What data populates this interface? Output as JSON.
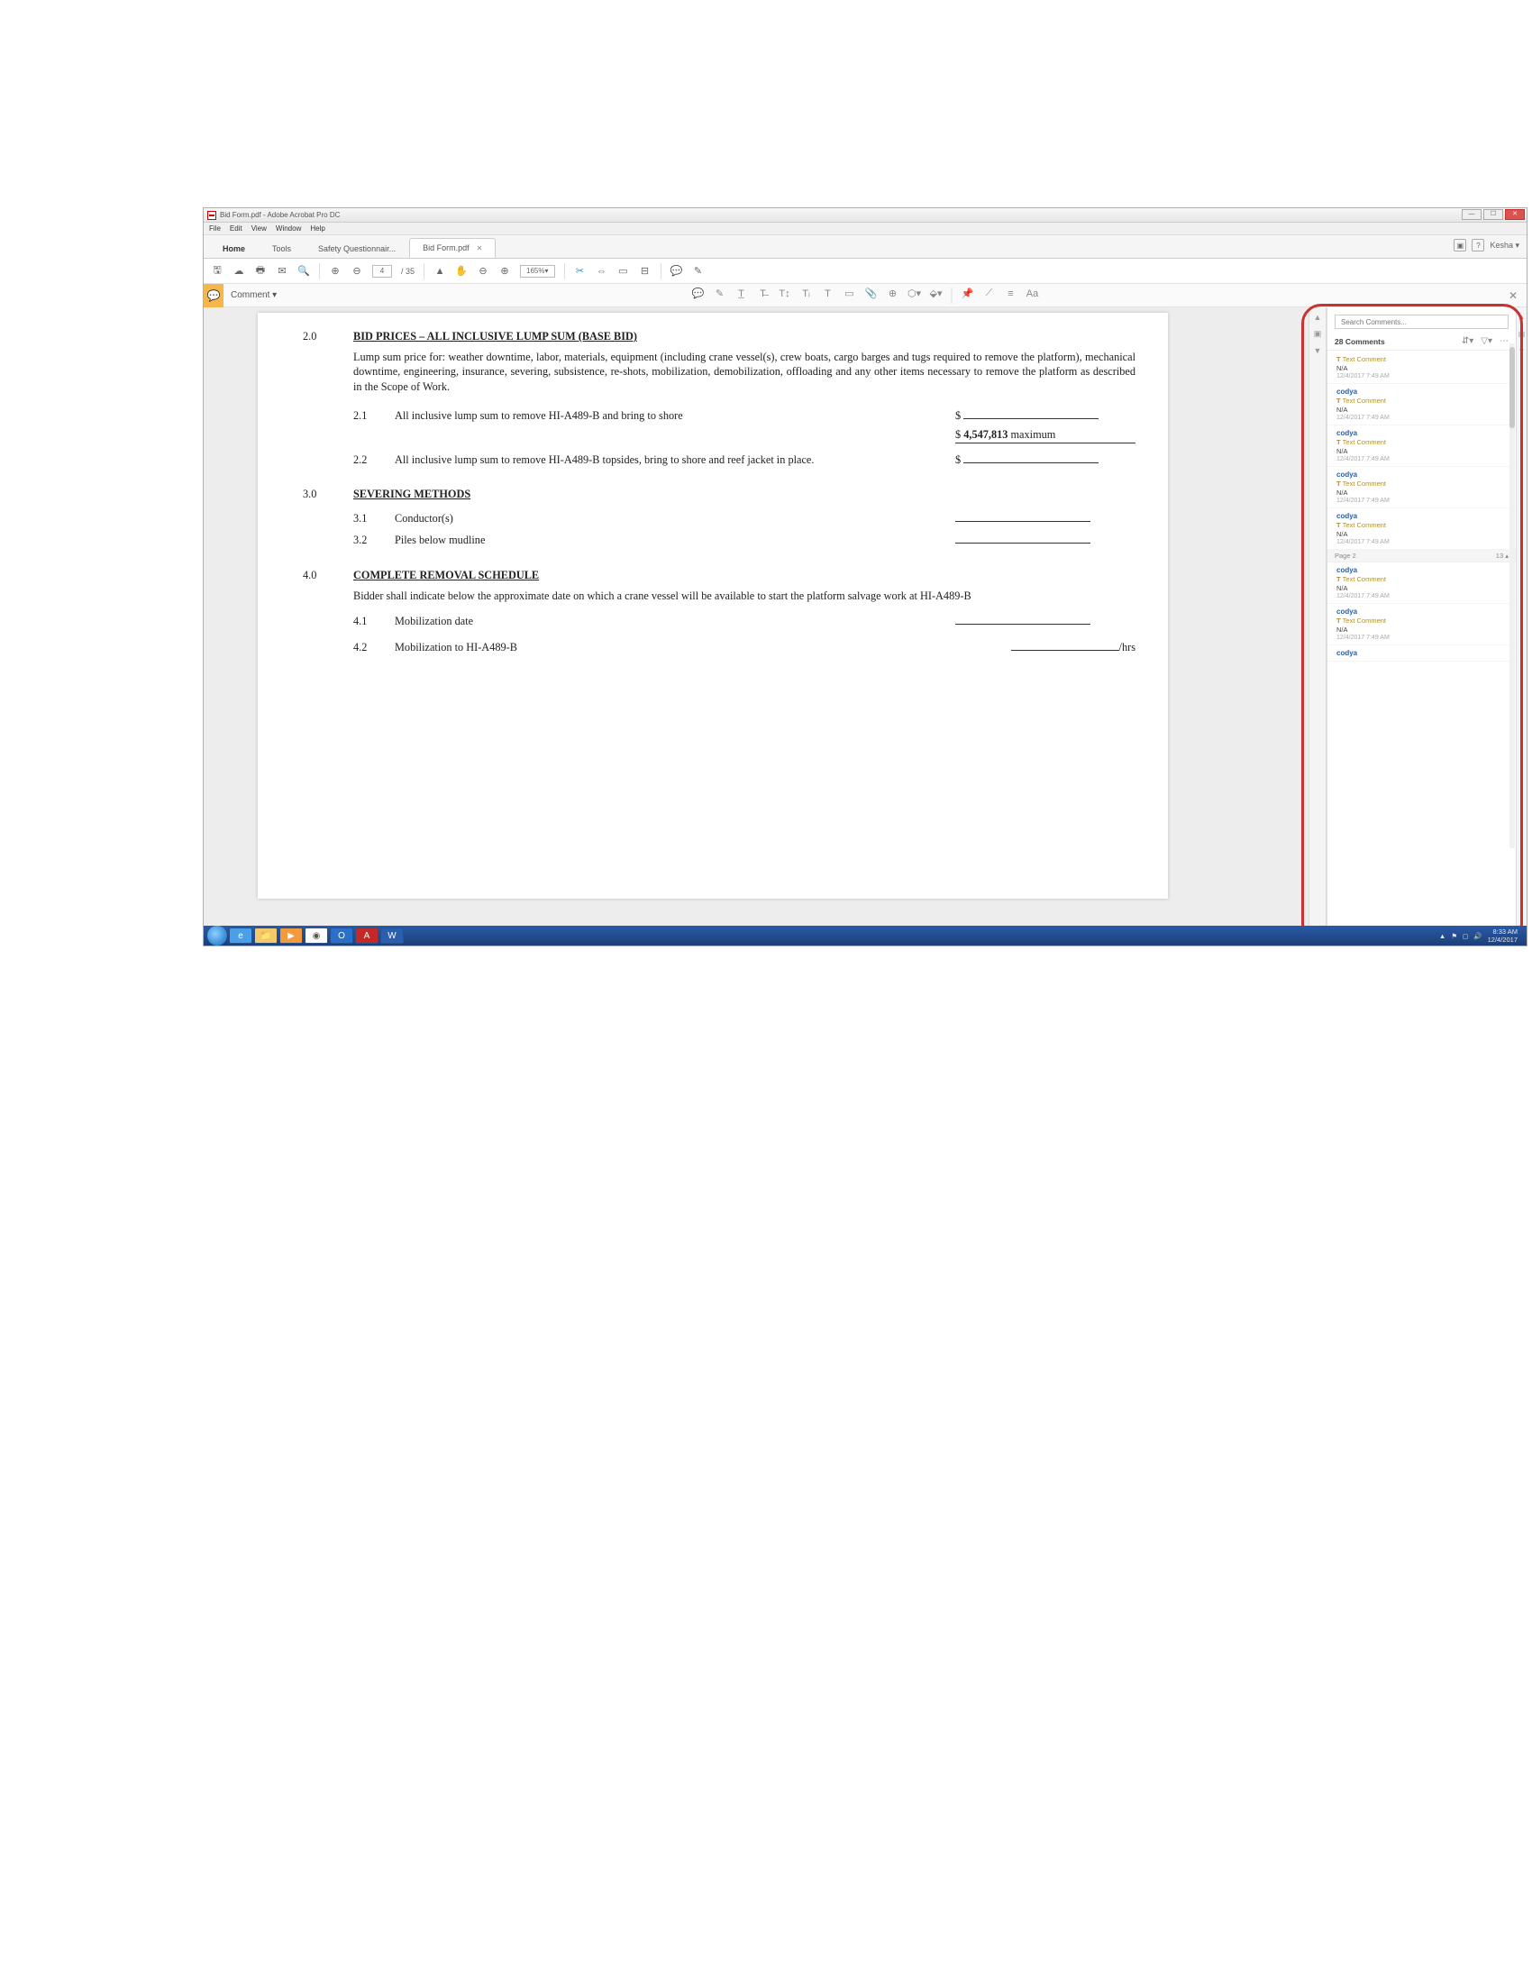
{
  "window": {
    "title": "Bid Form.pdf - Adobe Acrobat Pro DC",
    "menus": [
      "File",
      "Edit",
      "View",
      "Window",
      "Help"
    ],
    "tabs": {
      "home": "Home",
      "tools": "Tools",
      "docs": [
        "Safety Questionnair...",
        "Bid Form.pdf"
      ]
    },
    "user": "Kesha",
    "page_current": "4",
    "page_total": "/ 35",
    "zoom": "165%"
  },
  "comment_bar": {
    "label": "Comment"
  },
  "document": {
    "s20_num": "2.0",
    "s20_head": "BID PRICES – ALL INCLUSIVE LUMP SUM (BASE BID)",
    "s20_para": "Lump sum price for: weather downtime, labor, materials, equipment (including crane vessel(s), crew boats, cargo barges and tugs required to remove the platform), mechanical downtime, engineering, insurance, severing, subsistence, re-shots, mobilization, demobilization, offloading and any other items necessary to remove the platform as described in the Scope of Work.",
    "s21_num": "2.1",
    "s21_txt": "All inclusive lump sum to remove HI-A489-B and bring to shore",
    "s21_dollar": "$",
    "s21_val_dollar": "$",
    "s21_val_amount": "4,547,813",
    "s21_val_suffix": " maximum",
    "s22_num": "2.2",
    "s22_txt": "All inclusive lump sum to remove HI-A489-B topsides, bring to shore and reef jacket in place.",
    "s22_dollar": "$",
    "s30_num": "3.0",
    "s30_head": "SEVERING METHODS",
    "s31_num": "3.1",
    "s31_txt": "Conductor(s)",
    "s32_num": "3.2",
    "s32_txt": "Piles below mudline",
    "s40_num": "4.0",
    "s40_head": "COMPLETE REMOVAL SCHEDULE",
    "s40_para": "Bidder shall indicate below the approximate date on which a crane vessel will be available to start the platform salvage work at HI-A489-B",
    "s41_num": "4.1",
    "s41_txt": "Mobilization date",
    "s42_num": "4.2",
    "s42_txt": "Mobilization to HI-A489-B",
    "s42_unit": "/hrs"
  },
  "panel": {
    "search_placeholder": "Search Comments...",
    "count_label": "28 Comments",
    "page_sep_label": "Page 2",
    "page_sep_count": "13",
    "comments": [
      {
        "author": "",
        "type": "Text Comment",
        "body": "N/A",
        "ts": "12/4/2017 7:49 AM"
      },
      {
        "author": "codya",
        "type": "Text Comment",
        "body": "N/A",
        "ts": "12/4/2017 7:49 AM"
      },
      {
        "author": "codya",
        "type": "Text Comment",
        "body": "N/A",
        "ts": "12/4/2017 7:49 AM"
      },
      {
        "author": "codya",
        "type": "Text Comment",
        "body": "N/A",
        "ts": "12/4/2017 7:49 AM"
      },
      {
        "author": "codya",
        "type": "Text Comment",
        "body": "N/A",
        "ts": "12/4/2017 7:49 AM"
      },
      {
        "author": "codya",
        "type": "Text Comment",
        "body": "N/A",
        "ts": "12/4/2017 7:49 AM"
      },
      {
        "author": "codya",
        "type": "Text Comment",
        "body": "N/A",
        "ts": "12/4/2017 7:49 AM"
      },
      {
        "author": "codya",
        "type": "",
        "body": "",
        "ts": ""
      }
    ]
  },
  "taskbar": {
    "time": "8:33 AM",
    "date": "12/4/2017"
  }
}
